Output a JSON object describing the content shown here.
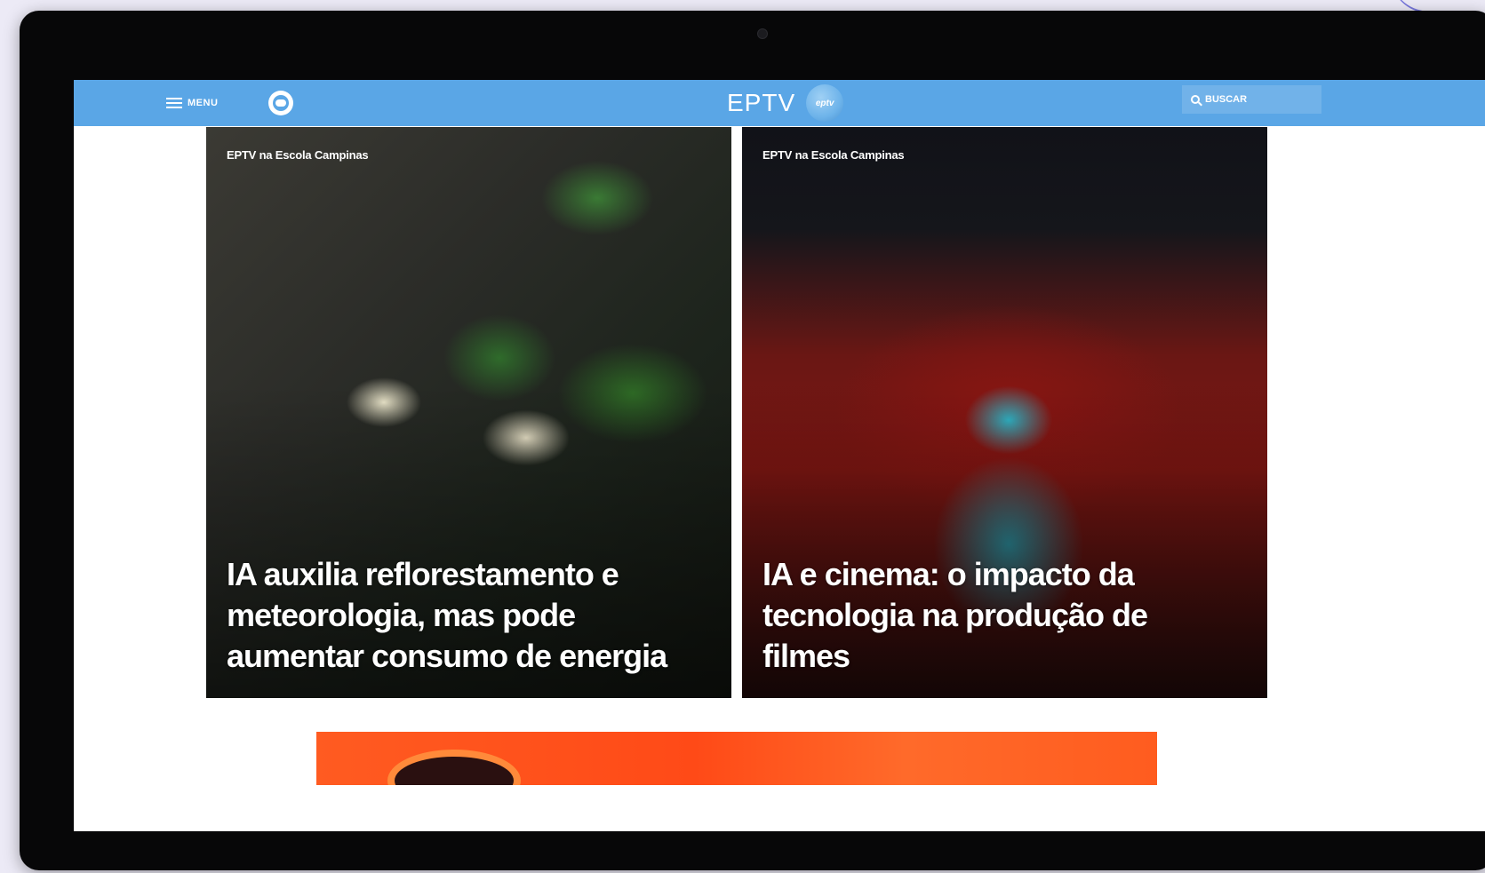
{
  "header": {
    "menu_label": "MENU",
    "brand_name": "EPTV",
    "brand_logo_text": "eptv",
    "search_label": "BUSCAR"
  },
  "cards": [
    {
      "tag": "EPTV na Escola Campinas",
      "title": "IA auxilia reflorestamento e meteorologia, mas pode aumentar consumo de energia"
    },
    {
      "tag": "EPTV na Escola Campinas",
      "title": "IA e cinema: o impacto da tecnologia na produção de filmes"
    }
  ],
  "colors": {
    "topbar": "#5aa6e6",
    "banner": "#ff5b21",
    "bezel": "#070708"
  },
  "icons": {
    "menu": "hamburger-icon",
    "globo": "globo-logo-icon",
    "search": "search-icon"
  }
}
